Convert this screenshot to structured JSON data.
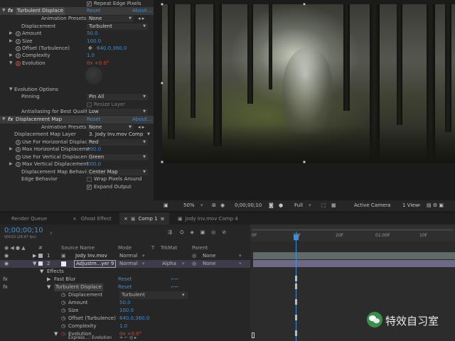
{
  "effect_controls": {
    "repeat_edge": "Repeat Edge Pixels",
    "turbulent": {
      "name": "Turbulent Displace",
      "reset": "Reset",
      "about": "About...",
      "animation_presets_label": "Animation Presets:",
      "animation_presets_value": "None",
      "displacement_label": "Displacement",
      "displacement_value": "Turbulent",
      "amount_label": "Amount",
      "amount_value": "50.0",
      "size_label": "Size",
      "size_value": "100.0",
      "offset_label": "Offset (Turbulence)",
      "offset_value": "640.0,360.0",
      "complexity_label": "Complexity",
      "complexity_value": "1.0",
      "evolution_label": "Evolution",
      "evolution_value": "0x +0.0°",
      "evolution_options_label": "Evolution Options",
      "pinning_label": "Pinning",
      "pinning_value": "Pin All",
      "resize_layer_label": "Resize Layer",
      "antialiasing_label": "Antialiasing for Best Qualit",
      "antialiasing_value": "Low"
    },
    "displacement_map": {
      "name": "Displacement Map",
      "reset": "Reset",
      "about": "About...",
      "animation_presets_label": "Animation Presets:",
      "animation_presets_value": "None",
      "map_layer_label": "Displacement Map Layer",
      "map_layer_value": "3. Jody Inv.mov Comp",
      "use_h_label": "Use For Horizontal Displac",
      "use_h_value": "Red",
      "max_h_label": "Max Horizontal Displaceme",
      "max_h_value": "200.0",
      "use_v_label": "Use For Vertical Displacem",
      "use_v_value": "Green",
      "max_v_label": "Max Vertical Displacement",
      "max_v_value": "200.0",
      "behavior_label": "Displacement Map Behavio",
      "behavior_value": "Center Map",
      "edge_label": "Edge Behavior",
      "wrap_label": "Wrap Pixels Around",
      "expand_label": "Expand Output"
    }
  },
  "viewer": {
    "zoom": "50%",
    "timecode": "0;00;00;10",
    "resolution": "Full",
    "camera": "Active Camera",
    "views": "1 View"
  },
  "tabs": [
    "Render Queue",
    "Ghost Effect",
    "Comp 1",
    "Jody Inv.mov Comp 4"
  ],
  "timeline": {
    "timecode": "0;00;00;10",
    "fps": "00010 (29.97 fps)",
    "col_source": "Source Name",
    "col_mode": "Mode",
    "col_t": "T",
    "col_trkmat": "TrkMat",
    "col_parent": "Parent",
    "layers": [
      {
        "num": "1",
        "name": "Jody Inv.mov",
        "mode": "Normal",
        "trkmat": "",
        "parent": "None"
      },
      {
        "num": "2",
        "name": "Adjustm...yer 9",
        "mode": "Normal",
        "trkmat": "Alpha",
        "parent": "None"
      }
    ],
    "effects_label": "Effects",
    "fast_blur": "Fast Blur",
    "fast_blur_reset": "Reset",
    "turbulent": "Turbulent Displace",
    "turbulent_reset": "Reset",
    "props": [
      {
        "label": "Displacement",
        "value": "Turbulent"
      },
      {
        "label": "Amount",
        "value": "50.0"
      },
      {
        "label": "Size",
        "value": "100.0"
      },
      {
        "label": "Offset (Turbulence)",
        "value": "640.0,360.0"
      },
      {
        "label": "Complexity",
        "value": "1.0"
      },
      {
        "label": "Evolution",
        "value": "0x +0.0°"
      },
      {
        "label": "Express...: Evolution",
        "value": ""
      }
    ],
    "ruler": [
      "0F",
      "10F",
      "20F",
      "01:00F",
      "10F"
    ]
  },
  "watermark": "特效自习室"
}
